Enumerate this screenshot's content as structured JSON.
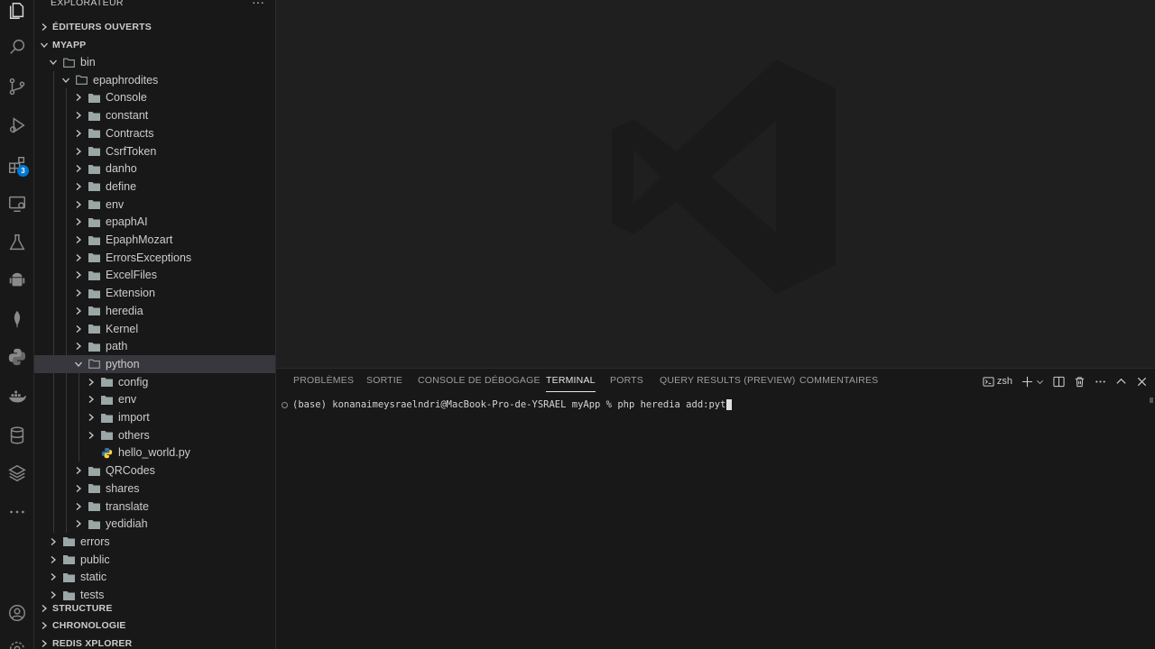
{
  "sidebar": {
    "title": "EXPLORATEUR",
    "sections": {
      "open_editors": "ÉDITEURS OUVERTS",
      "project": "MYAPP",
      "structure": "STRUCTURE",
      "timeline": "CHRONOLOGIE",
      "redis": "REDIS XPLORER"
    },
    "tree": [
      {
        "label": "bin",
        "depth": 1,
        "type": "folder",
        "expanded": true
      },
      {
        "label": "epaphrodites",
        "depth": 2,
        "type": "folder",
        "expanded": true
      },
      {
        "label": "Console",
        "depth": 3,
        "type": "folder",
        "expanded": false
      },
      {
        "label": "constant",
        "depth": 3,
        "type": "folder",
        "expanded": false
      },
      {
        "label": "Contracts",
        "depth": 3,
        "type": "folder",
        "expanded": false
      },
      {
        "label": "CsrfToken",
        "depth": 3,
        "type": "folder",
        "expanded": false
      },
      {
        "label": "danho",
        "depth": 3,
        "type": "folder",
        "expanded": false
      },
      {
        "label": "define",
        "depth": 3,
        "type": "folder",
        "expanded": false
      },
      {
        "label": "env",
        "depth": 3,
        "type": "folder",
        "expanded": false
      },
      {
        "label": "epaphAI",
        "depth": 3,
        "type": "folder",
        "expanded": false
      },
      {
        "label": "EpaphMozart",
        "depth": 3,
        "type": "folder",
        "expanded": false
      },
      {
        "label": "ErrorsExceptions",
        "depth": 3,
        "type": "folder",
        "expanded": false
      },
      {
        "label": "ExcelFiles",
        "depth": 3,
        "type": "folder",
        "expanded": false
      },
      {
        "label": "Extension",
        "depth": 3,
        "type": "folder",
        "expanded": false
      },
      {
        "label": "heredia",
        "depth": 3,
        "type": "folder",
        "expanded": false
      },
      {
        "label": "Kernel",
        "depth": 3,
        "type": "folder",
        "expanded": false
      },
      {
        "label": "path",
        "depth": 3,
        "type": "folder",
        "expanded": false
      },
      {
        "label": "python",
        "depth": 3,
        "type": "folder",
        "expanded": true,
        "selected": true
      },
      {
        "label": "config",
        "depth": 4,
        "type": "folder",
        "expanded": false
      },
      {
        "label": "env",
        "depth": 4,
        "type": "folder",
        "expanded": false
      },
      {
        "label": "import",
        "depth": 4,
        "type": "folder",
        "expanded": false
      },
      {
        "label": "others",
        "depth": 4,
        "type": "folder",
        "expanded": false
      },
      {
        "label": "hello_world.py",
        "depth": 4,
        "type": "python-file"
      },
      {
        "label": "QRCodes",
        "depth": 3,
        "type": "folder",
        "expanded": false
      },
      {
        "label": "shares",
        "depth": 3,
        "type": "folder",
        "expanded": false
      },
      {
        "label": "translate",
        "depth": 3,
        "type": "folder",
        "expanded": false
      },
      {
        "label": "yedidiah",
        "depth": 3,
        "type": "folder",
        "expanded": false
      },
      {
        "label": "errors",
        "depth": 1,
        "type": "folder",
        "expanded": false
      },
      {
        "label": "public",
        "depth": 1,
        "type": "folder",
        "expanded": false
      },
      {
        "label": "static",
        "depth": 1,
        "type": "folder",
        "expanded": false
      },
      {
        "label": "tests",
        "depth": 1,
        "type": "folder",
        "expanded": false
      }
    ]
  },
  "activity_bar": {
    "extensions_badge": "3"
  },
  "panel": {
    "tabs": [
      "PROBLÈMES",
      "SORTIE",
      "CONSOLE DE DÉBOGAGE",
      "TERMINAL",
      "PORTS",
      "QUERY RESULTS (PREVIEW)",
      "COMMENTAIRES"
    ],
    "active_tab": "TERMINAL",
    "shell_name": "zsh",
    "terminal_prompt": "(base) konanaimeysraelndri@MacBook-Pro-de-YSRAEL myApp % php heredia add:pyt"
  },
  "colors": {
    "folder": "#9aa7a6",
    "python_blue": "#3572A5",
    "python_yellow": "#FFD43B",
    "badge": "#0078d4"
  }
}
